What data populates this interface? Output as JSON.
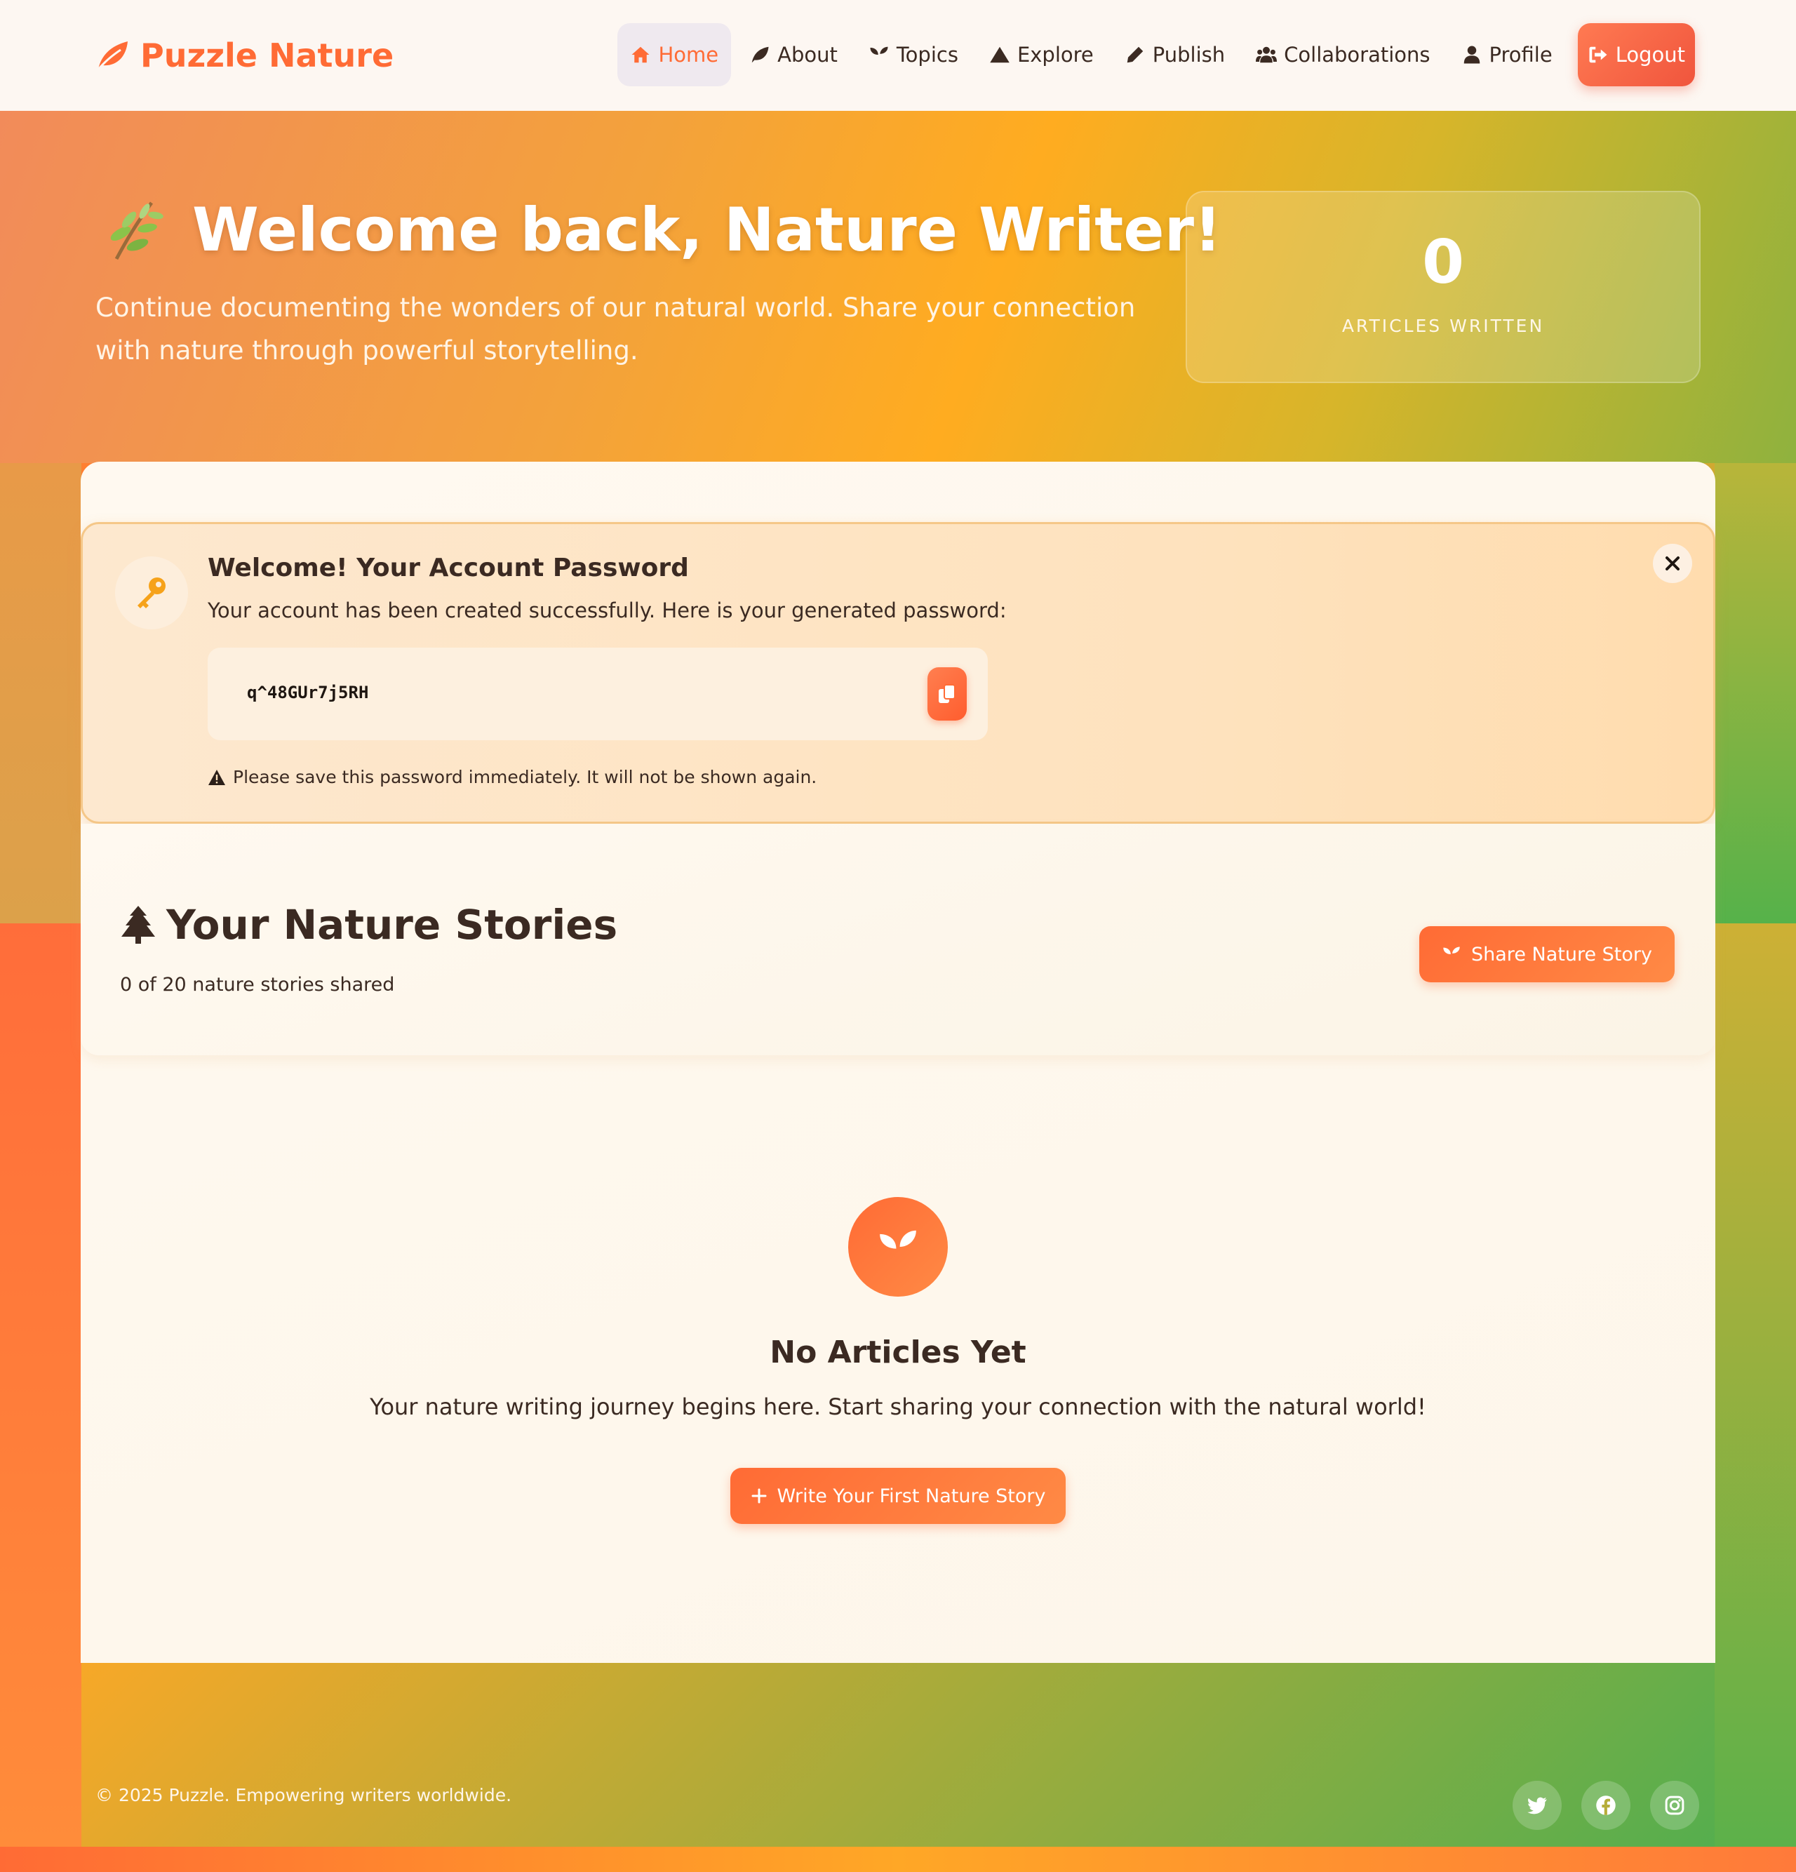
{
  "brand": {
    "name": "Puzzle Nature",
    "color": "#ff6b35",
    "icon": "leaf-icon"
  },
  "nav": {
    "items": [
      {
        "label": "Home",
        "icon": "home-icon",
        "active": true
      },
      {
        "label": "About",
        "icon": "leaf-icon"
      },
      {
        "label": "Topics",
        "icon": "seedling-icon"
      },
      {
        "label": "Explore",
        "icon": "mountain-icon"
      },
      {
        "label": "Publish",
        "icon": "pen-icon"
      },
      {
        "label": "Collaborations",
        "icon": "users-icon"
      },
      {
        "label": "Profile",
        "icon": "user-icon"
      },
      {
        "label": "Logout",
        "icon": "logout-icon"
      }
    ]
  },
  "hero": {
    "title": "Welcome back, Nature Writer!",
    "subtitle": "Continue documenting the wonders of our natural world. Share your connection with nature through powerful storytelling.",
    "stat": {
      "value": "0",
      "label": "ARTICLES WRITTEN"
    }
  },
  "alert": {
    "title": "Welcome! Your Account Password",
    "text": "Your account has been created successfully. Here is your generated password:",
    "password": "q^48GUr7j5RH",
    "warning": "Please save this password immediately. It will not be shown again."
  },
  "stories": {
    "title": "Your Nature Stories",
    "count_text": "0 of 20 nature stories shared",
    "share_label": "Share Nature Story"
  },
  "empty": {
    "title": "No Articles Yet",
    "text": "Your nature writing journey begins here. Start sharing your connection with the natural world!",
    "button_label": "Write Your First Nature Story"
  },
  "footer": {
    "copyright": "© 2025 Puzzle. Empowering writers worldwide.",
    "social": [
      "twitter-icon",
      "facebook-icon",
      "instagram-icon"
    ]
  },
  "colors": {
    "accent": "#ff6b35",
    "text": "#3b2a22",
    "green": "#4caf50",
    "amber": "#ffa726"
  }
}
